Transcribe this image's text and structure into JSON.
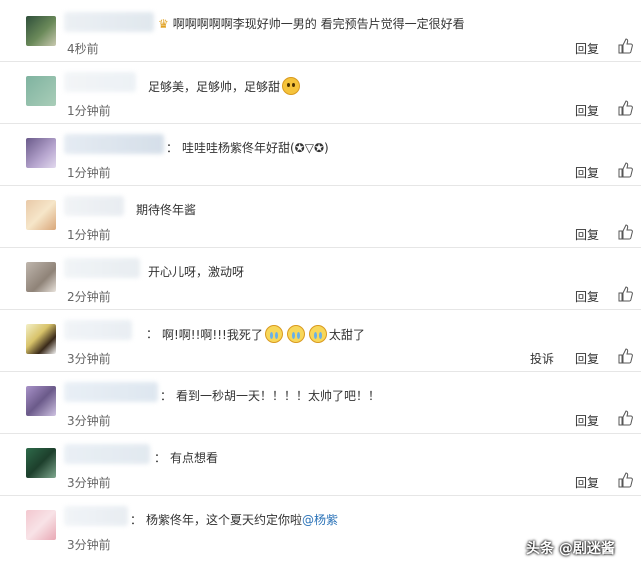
{
  "comments": [
    {
      "text": "啊啊啊啊啊李现好帅一男的 看完预告片觉得一定很好看",
      "time": "4秒前",
      "reply": "回复"
    },
    {
      "text": "足够美，足够帅，足够甜",
      "time": "1分钟前",
      "reply": "回复"
    },
    {
      "text": "哇哇哇杨紫佟年好甜(✪▽✪)",
      "time": "1分钟前",
      "reply": "回复"
    },
    {
      "text": "期待佟年酱",
      "time": "1分钟前",
      "reply": "回复"
    },
    {
      "text": "开心儿呀，激动呀",
      "time": "2分钟前",
      "reply": "回复"
    },
    {
      "text_a": "啊!啊!!啊!!!我死了",
      "text_b": "太甜了",
      "time": "3分钟前",
      "reply": "回复",
      "report": "投诉"
    },
    {
      "text": "看到一秒胡一天！！！！太帅了吧！！",
      "time": "3分钟前",
      "reply": "回复"
    },
    {
      "text": "有点想看",
      "time": "3分钟前",
      "reply": "回复"
    },
    {
      "text": "杨紫佟年，这个夏天约定你啦",
      "mention": "@杨紫",
      "time": "3分钟前"
    }
  ],
  "watermark": "头条 @剧迷酱",
  "icons": {
    "like": "thumbs-up-icon",
    "laugh": "laughing-emoji-icon",
    "cry": "crying-emoji-icon",
    "crown": "crown-icon"
  }
}
